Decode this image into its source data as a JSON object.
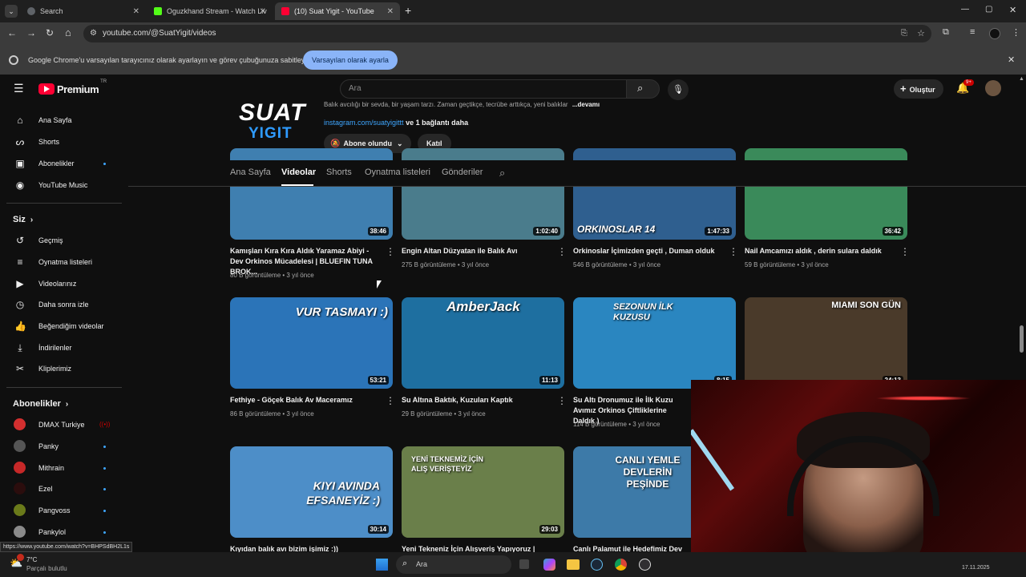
{
  "browser": {
    "tabs": [
      {
        "label": "Search",
        "color": "#5f6368"
      },
      {
        "label": "Oguzkhand Stream - Watch Liv",
        "color": "#53fc18"
      },
      {
        "label": "(10) Suat Yigit - YouTube",
        "color": "#ff0033"
      }
    ],
    "url": "youtube.com/@SuatYigit/videos",
    "infobar_text": "Google Chrome'u varsayılan tarayıcınız olarak ayarlayın ve görev çubuğunuza sabitleyin",
    "infobar_button": "Varsayılan olarak ayarla"
  },
  "youtube": {
    "logo_text": "Premium",
    "logo_sup": "TR",
    "search_placeholder": "Ara",
    "create_label": "Oluştur",
    "notif_count": "9+"
  },
  "sidebar": {
    "main": [
      {
        "label": "Ana Sayfa",
        "icon": "home-icon",
        "glyph": "⌂"
      },
      {
        "label": "Shorts",
        "icon": "shorts-icon",
        "glyph": "ᔕ"
      },
      {
        "label": "Abonelikler",
        "icon": "subscriptions-icon",
        "glyph": "▣"
      },
      {
        "label": "YouTube Music",
        "icon": "music-icon",
        "glyph": "◉"
      }
    ],
    "you_header": "Siz",
    "you": [
      {
        "label": "Geçmiş",
        "icon": "history-icon",
        "glyph": "↺"
      },
      {
        "label": "Oynatma listeleri",
        "icon": "playlist-icon",
        "glyph": "≡"
      },
      {
        "label": "Videolarınız",
        "icon": "your-videos-icon",
        "glyph": "▶"
      },
      {
        "label": "Daha sonra izle",
        "icon": "watch-later-icon",
        "glyph": "◷"
      },
      {
        "label": "Beğendiğim videolar",
        "icon": "like-icon",
        "glyph": "👍"
      },
      {
        "label": "İndirilenler",
        "icon": "download-icon",
        "glyph": "⤓"
      },
      {
        "label": "Kliplerimiz",
        "icon": "clip-icon",
        "glyph": "✂"
      }
    ],
    "subs_header": "Abonelikler",
    "subs": [
      {
        "label": "DMAX Turkiye",
        "color": "#d32f2f"
      },
      {
        "label": "Panky",
        "color": "#555555"
      },
      {
        "label": "Mithrain",
        "color": "#c62828"
      },
      {
        "label": "Ezel",
        "color": "#2b0d0d"
      },
      {
        "label": "Pangvoss",
        "color": "#6a7a1a"
      },
      {
        "label": "Pankylol",
        "color": "#8a8a8a"
      }
    ]
  },
  "channel": {
    "logo_line1": "SUAT",
    "logo_line2": "YIGIT",
    "description": "Balık avcılığı bir sevda, bir yaşam tarzı. Zaman geçtikçe, tecrübe arttıkça, yeni balıklar",
    "more": "...devamı",
    "link": "instagram.com/suatyigittt",
    "link_more": "ve 1 bağlantı daha",
    "subscribed_label": "Abone olundu",
    "join_label": "Katıl",
    "tabs": [
      "Ana Sayfa",
      "Videolar",
      "Shorts",
      "Oynatma listeleri",
      "Gönderiler"
    ]
  },
  "videos": [
    {
      "title": "Kamışları Kıra Kıra Aldık Yaramaz Abiyi - Dev Orkinos Mücadelesi | BLUEFIN TUNA BROK...",
      "meta": "80 B görüntüleme • 3 yıl önce",
      "duration": "38:46",
      "bg": "#3f7fb0",
      "overlay": ""
    },
    {
      "title": "Engin Altan Düzyatan ile Balık Avı",
      "meta": "275 B görüntüleme • 3 yıl önce",
      "duration": "1:02:40",
      "bg": "#4a7c8c",
      "overlay": ""
    },
    {
      "title": "Orkinoslar İçimizden geçti , Duman olduk",
      "meta": "546 B görüntüleme • 3 yıl önce",
      "duration": "1:47:33",
      "bg": "#2f5f8f",
      "overlay": "ORKINOSLAR 14"
    },
    {
      "title": "Nail Amcamızı aldık , derin sulara daldık",
      "meta": "59 B görüntüleme • 3 yıl önce",
      "duration": "36:42",
      "bg": "#3a8a5a",
      "overlay": ""
    },
    {
      "title": "Fethiye - Göçek Balık Av Maceramız",
      "meta": "86 B görüntüleme • 3 yıl önce",
      "duration": "53:21",
      "bg": "#2b74b8",
      "overlay": "VUR TASMAYI :)"
    },
    {
      "title": "Su Altına Baktık, Kuzuları Kaptık",
      "meta": "29 B görüntüleme • 3 yıl önce",
      "duration": "11:13",
      "bg": "#1e6fa0",
      "overlay": "AmberJack"
    },
    {
      "title": "Su Altı Dronumuz ile İlk Kuzu Avımız Orkinos Çiftliklerine Daldık )",
      "meta": "114 B görüntüleme • 3 yıl önce",
      "duration": "8:15",
      "bg": "#2a86c0",
      "overlay": "SEZONUN İLK KUZUSU"
    },
    {
      "title": "",
      "meta": "",
      "duration": "24:13",
      "bg": "#4a3a2a",
      "overlay": "MIAMI SON GÜN"
    },
    {
      "title": "Kıyıdan balık avı bizim işimiz :))",
      "meta": "",
      "duration": "30:14",
      "bg": "#4d8ec8",
      "overlay": "KIYI AVINDA EFSANEYİZ :)"
    },
    {
      "title": "Yeni Tekneniz İçin Alışveriş Yapıyoruz |",
      "meta": "",
      "duration": "29:03",
      "bg": "#6a7f4a",
      "overlay": "YENİ TEKNEMİZ İÇİN ALIŞ VERİŞTEYİZ"
    },
    {
      "title": "Canlı Palamut ile Hedefimiz Dev KIL",
      "meta": "",
      "duration": "",
      "bg": "#3d7aa8",
      "overlay": "CANLI YEMLE DEVLERİN PEŞİNDE"
    }
  ],
  "status_url": "https://www.youtube.com/watch?v=BHPSdBH2L1s",
  "taskbar": {
    "weather_temp": "7°C",
    "weather_desc": "Parçalı bulutlu",
    "search_label": "Ara",
    "date": "17.11.2025"
  }
}
